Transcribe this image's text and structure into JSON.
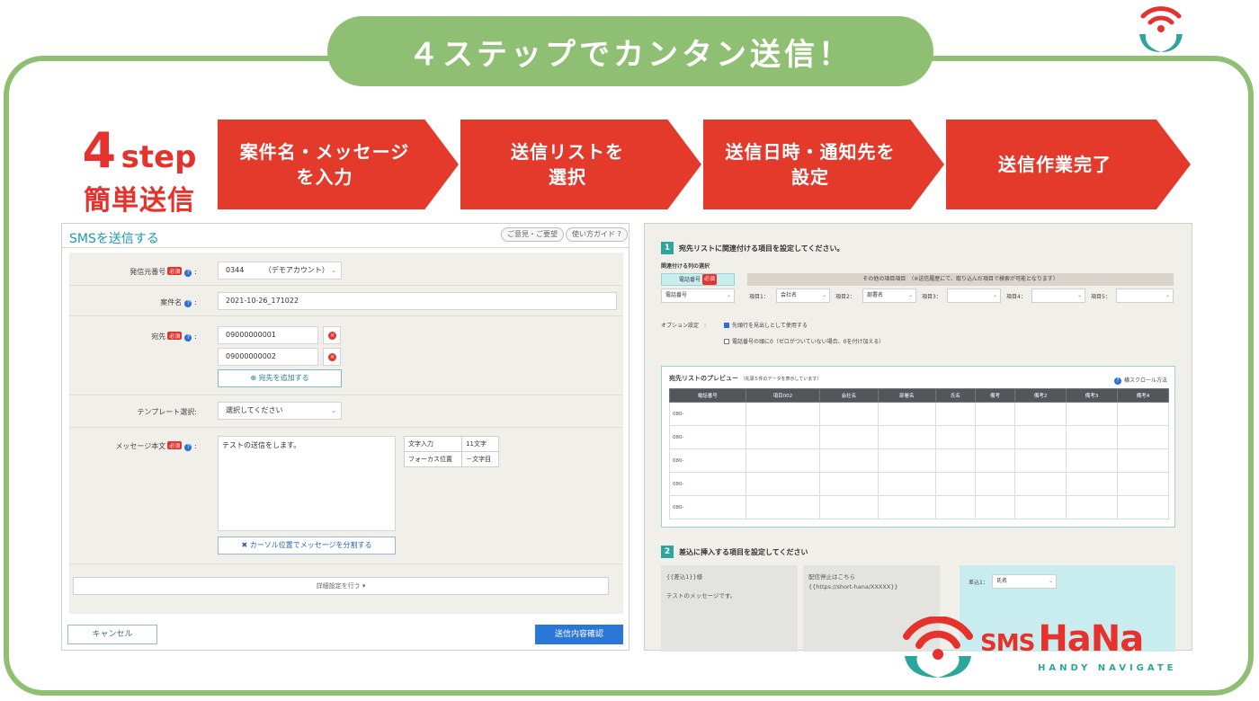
{
  "banner": "４ステップでカンタン送信！",
  "step_label": {
    "num": "4",
    "word": "step",
    "sub": "簡単送信"
  },
  "steps": [
    "案件名・メッセージ\nを入力",
    "送信リストを\n選択",
    "送信日時・通知先を\n設定",
    "送信作業完了"
  ],
  "colors": {
    "frame": "#8fbf73",
    "step_red": "#e43a2c",
    "teal": "#2aa69b",
    "primary": "#2b77d8"
  },
  "left_panel": {
    "title": "SMSを送信する",
    "feedback_btn": "ご意見・ご要望",
    "guide_btn": "使い方ガイド",
    "sender_label": "発信元番号",
    "sender_value": "0344",
    "sender_account": "（デモアカウント）",
    "required_badge": "必須",
    "case_label": "案件名",
    "case_value": "2021-10-26_171022",
    "dest_label": "宛先",
    "dest_values": [
      "09000000001",
      "09000000002"
    ],
    "add_dest_btn": "宛先を追加する",
    "template_label": "テンプレート選択",
    "template_value": "選択してください",
    "message_label": "メッセージ本文",
    "message_value": "テストの送信をします。",
    "count_rows": [
      {
        "label": "文字入力",
        "value": "11文字"
      },
      {
        "label": "フォーカス位置",
        "value": "－文字目"
      }
    ],
    "split_btn": "カーソル位置でメッセージを分割する",
    "detail_btn": "詳細設定を行う ▾",
    "cancel_btn": "キャンセル",
    "confirm_btn": "送信内容確認"
  },
  "right_panel": {
    "sec1_num": "1",
    "sec1_title": "宛先リストに関連付ける項目を設定してください。",
    "col_select_label": "関連付ける列の選択",
    "phone_tab": "電話番号",
    "required_badge": "必須",
    "other_header": "その他の項目項目　（※送信履歴にて、取り込んだ項目で検索が可能となります）",
    "phone_select": "電話番号",
    "item_selects": [
      {
        "label": "項目1：",
        "value": "会社名"
      },
      {
        "label": "項目2：",
        "value": "部署名"
      },
      {
        "label": "項目3：",
        "value": ""
      },
      {
        "label": "項目4：",
        "value": ""
      },
      {
        "label": "項目5：",
        "value": ""
      }
    ],
    "option_label": "オプション設定",
    "option1": "先頭行を見出しとして使用する",
    "option2": "電話番号の頭に0（ゼロがついていない場合、0を付け加える）",
    "preview_title": "宛先リストのプレビュー",
    "preview_note": "（先頭５件のデータを表示しています）",
    "scroll_help": "横スクロール方法",
    "preview_headers": [
      "電話番号",
      "項目002",
      "会社名",
      "部署名",
      "氏名",
      "備考",
      "備考2",
      "備考3",
      "備考4"
    ],
    "preview_rows": [
      "080-",
      "080-",
      "080-",
      "080-",
      "080-"
    ],
    "sec2_num": "2",
    "sec2_title": "差込に挿入する項目を設定してください",
    "insert_box1_line1": "{{差込1}}様",
    "insert_box1_line2": "テストのメッセージです。",
    "insert_box2_line1": "配信停止はこちら",
    "insert_box2_line2": "{{https://short-hana/XXXXX}}",
    "insert_select_label": "差込1：",
    "insert_select_value": "氏名"
  },
  "brand": {
    "sms": "SMS",
    "name": "HaNa",
    "sub": "HANDY NAVIGATE"
  }
}
